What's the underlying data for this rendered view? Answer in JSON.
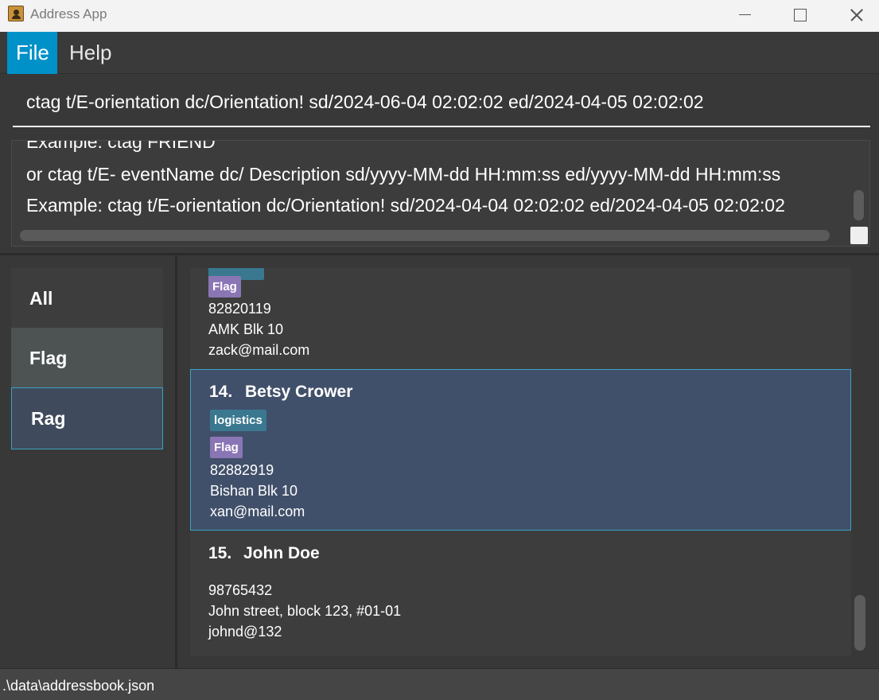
{
  "window": {
    "title": "Address App",
    "icon": "address-book-icon",
    "controls": [
      "minimize-icon",
      "maximize-icon",
      "close-icon"
    ]
  },
  "menu": {
    "items": [
      {
        "label": "File",
        "active": true
      },
      {
        "label": "Help",
        "active": false
      }
    ],
    "accent_color": "#0091c8"
  },
  "command": {
    "value": "ctag t/E-orientation dc/Orientation! sd/2024-06-04 02:02:02 ed/2024-04-05 02:02:02"
  },
  "result": {
    "lines": [
      "Example: ctag FRIEND",
      "or ctag t/E- eventName dc/ Description sd/yyyy-MM-dd HH:mm:ss ed/yyyy-MM-dd HH:mm:ss",
      "Example: ctag t/E-orientation dc/Orientation! sd/2024-04-04 02:02:02 ed/2024-04-05 02:02:02"
    ]
  },
  "tags": {
    "items": [
      {
        "label": "All"
      },
      {
        "label": "Flag"
      },
      {
        "label": "Rag",
        "selected": true
      }
    ]
  },
  "persons": {
    "previous": {
      "tags": [
        "Flag"
      ],
      "phone": "82820119",
      "address": "AMK Blk 10",
      "email": "zack@mail.com"
    },
    "selected": {
      "index": "14.",
      "name": "Betsy Crower",
      "tags": [
        "logistics",
        "Flag"
      ],
      "phone": "82882919",
      "address": "Bishan Blk 10",
      "email": "xan@mail.com"
    },
    "next": {
      "index": "15.",
      "name": "John Doe",
      "phone": "98765432",
      "address": "John street, block 123, #01-01",
      "email": "johnd@132"
    },
    "colors": {
      "selected_bg": "#41506a",
      "selected_border": "#3aa3c0",
      "tag_teal": "#3a7890",
      "tag_purple": "#8a76b5"
    }
  },
  "status": {
    "path": ".\\data\\addressbook.json"
  }
}
